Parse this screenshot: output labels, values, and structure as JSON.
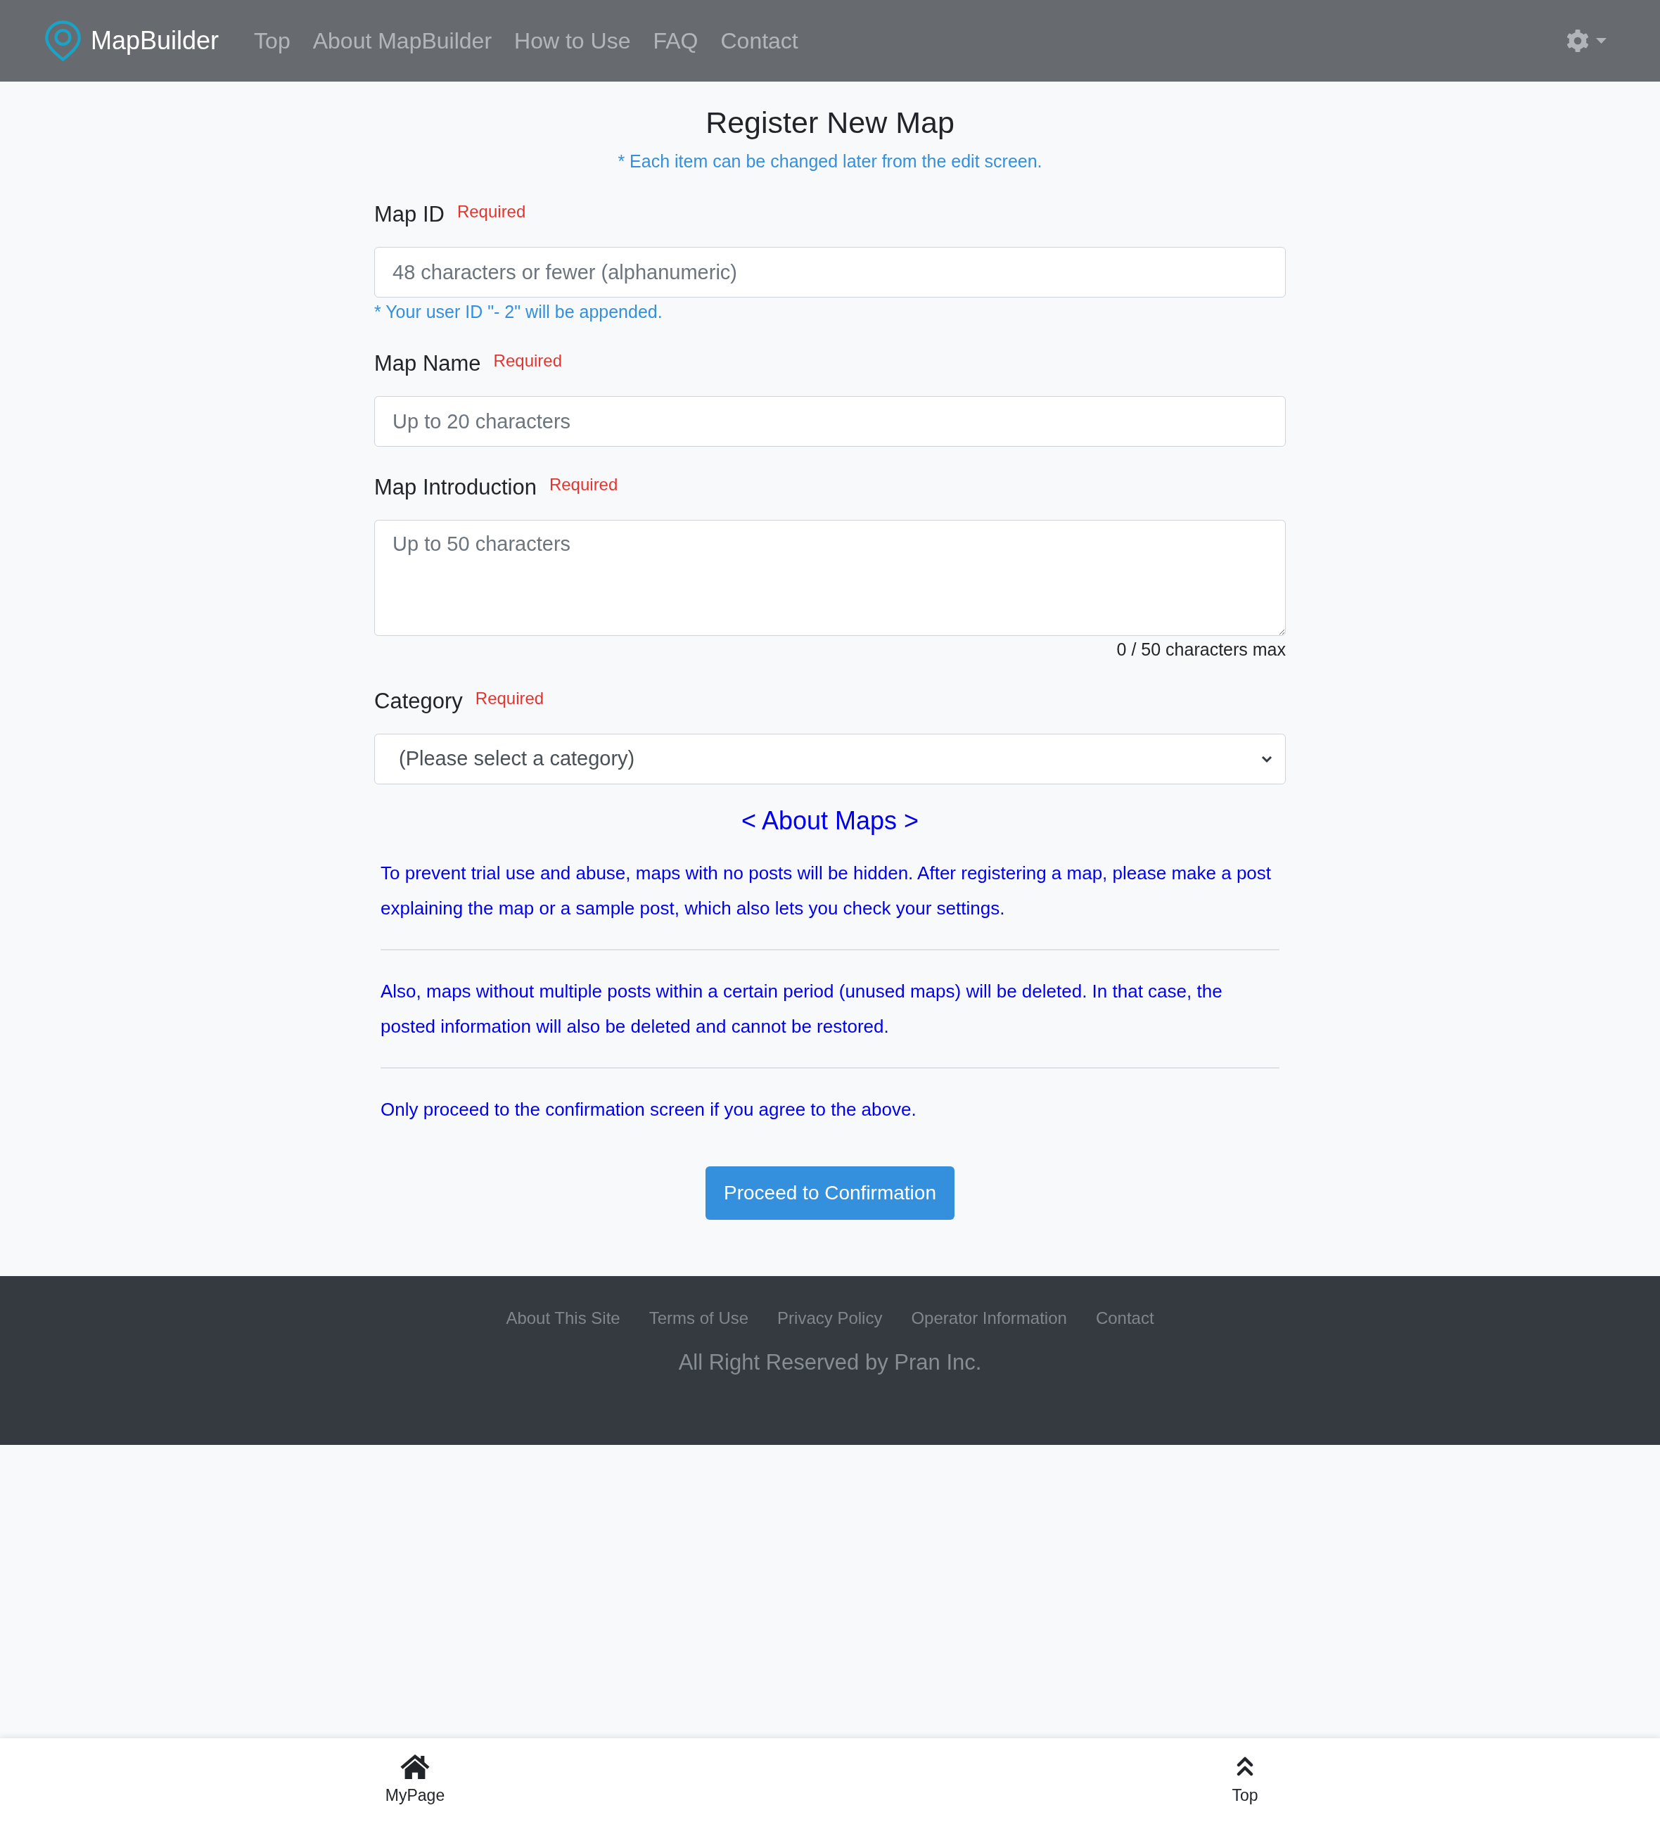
{
  "navbar": {
    "brand": "MapBuilder",
    "links": [
      "Top",
      "About MapBuilder",
      "How to Use",
      "FAQ",
      "Contact"
    ]
  },
  "page": {
    "title": "Register New Map",
    "note": "* Each item can be changed later from the edit screen."
  },
  "form": {
    "fields": [
      {
        "kind": "input",
        "label": "Map ID",
        "badge": "Required",
        "placeholder": "48 characters or fewer (alphanumeric)",
        "help": "* Your user ID \"- 2\" will be appended."
      },
      {
        "kind": "input",
        "label": "Map Name",
        "badge": "Required",
        "placeholder": "Up to 20 characters"
      },
      {
        "kind": "textarea",
        "label": "Map Introduction",
        "badge": "Required",
        "placeholder": "Up to 50 characters",
        "counter": "0 / 50 characters max"
      },
      {
        "kind": "select",
        "label": "Category",
        "badge": "Required",
        "value": "(Please select a category)"
      }
    ]
  },
  "about": {
    "heading": "< About Maps >",
    "paragraphs": [
      "To prevent trial use and abuse, maps with no posts will be hidden. After registering a map, please make a post explaining the map or a sample post, which also lets you check your settings.",
      "Also, maps without multiple posts within a certain period (unused maps) will be deleted. In that case, the posted information will also be deleted and cannot be restored.",
      "Only proceed to the confirmation screen if you agree to the above."
    ]
  },
  "submit_button": "Proceed to Confirmation",
  "footer": {
    "links": [
      "About This Site",
      "Terms of Use",
      "Privacy Policy",
      "Operator Information",
      "Contact"
    ],
    "copyright": "All Right Reserved by Pran Inc."
  },
  "bottom_nav": [
    {
      "kind": "home",
      "label": "MyPage"
    },
    {
      "kind": "top",
      "label": "Top"
    }
  ]
}
